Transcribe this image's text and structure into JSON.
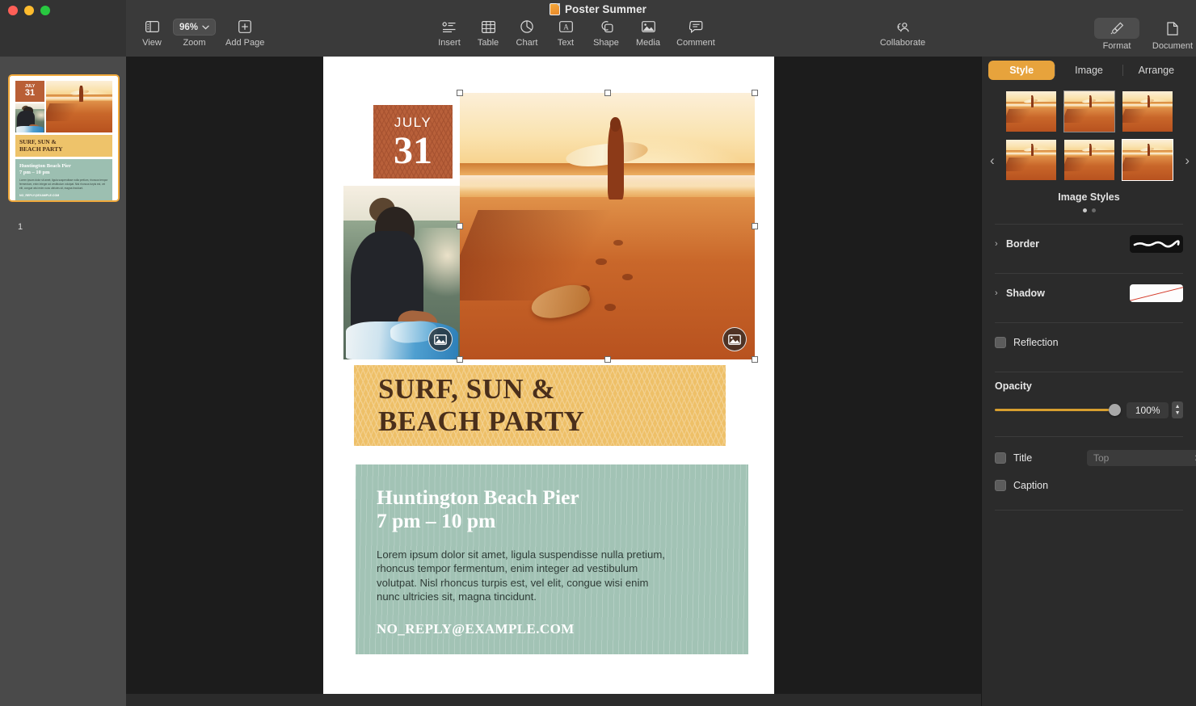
{
  "window": {
    "title": "Poster Summer",
    "traffic_lights": [
      "close",
      "minimize",
      "zoom"
    ]
  },
  "toolbar": {
    "left": [
      {
        "name": "view",
        "label": "View",
        "icon": "sidebar-icon"
      },
      {
        "name": "zoom",
        "label": "Zoom",
        "icon": "chevron-down-icon",
        "value": "96%"
      },
      {
        "name": "add-page",
        "label": "Add Page",
        "icon": "plus-box-icon"
      }
    ],
    "center": [
      {
        "name": "insert",
        "label": "Insert",
        "icon": "insert-icon"
      },
      {
        "name": "table",
        "label": "Table",
        "icon": "table-icon"
      },
      {
        "name": "chart",
        "label": "Chart",
        "icon": "chart-pie-icon"
      },
      {
        "name": "text",
        "label": "Text",
        "icon": "text-box-icon"
      },
      {
        "name": "shape",
        "label": "Shape",
        "icon": "shape-icon"
      },
      {
        "name": "media",
        "label": "Media",
        "icon": "media-image-icon"
      },
      {
        "name": "comment",
        "label": "Comment",
        "icon": "comment-icon"
      }
    ],
    "right": [
      {
        "name": "collaborate",
        "label": "Collaborate",
        "icon": "collaborate-icon"
      },
      {
        "name": "format",
        "label": "Format",
        "icon": "paintbrush-icon",
        "active": true
      },
      {
        "name": "document",
        "label": "Document",
        "icon": "document-icon"
      }
    ]
  },
  "navigator": {
    "page_number": "1",
    "thumbnail_selected": true
  },
  "poster": {
    "date": {
      "month": "JULY",
      "day": "31"
    },
    "headline_line1": "SURF, SUN &",
    "headline_line2": "BEACH PARTY",
    "venue_line1": "Huntington Beach Pier",
    "venue_line2": "7 pm – 10 pm",
    "body": "Lorem ipsum dolor sit amet, ligula suspendisse nulla pretium, rhoncus tempor fermentum, enim integer ad vestibulum volutpat. Nisl rhoncus turpis est, vel elit, congue wisi enim nunc ultricies sit, magna tincidunt.",
    "email": "NO_REPLY@EXAMPLE.COM",
    "images": [
      {
        "name": "surfer-on-wave-photo",
        "badge": "image-placeholder-icon"
      },
      {
        "name": "surfer-sunset-beach-photo",
        "badge": "image-placeholder-icon",
        "selected": true
      }
    ],
    "colors": {
      "date_badge": "#b8603a",
      "headline_band": "#eec068",
      "headline_text": "#4a2f1b",
      "info_panel": "#a2c3b5",
      "panel_heading": "#ffffff"
    }
  },
  "inspector": {
    "tabs": [
      {
        "name": "style",
        "label": "Style",
        "selected": true
      },
      {
        "name": "image",
        "label": "Image",
        "selected": false
      },
      {
        "name": "arrange",
        "label": "Arrange",
        "selected": false
      }
    ],
    "styles": {
      "label": "Image Styles",
      "prev_arrow": "‹",
      "next_arrow": "›",
      "page_dots": 2,
      "active_dot": 1,
      "cells": [
        {
          "name": "image-style-1",
          "selected": false
        },
        {
          "name": "image-style-2",
          "selected": "hover"
        },
        {
          "name": "image-style-3",
          "selected": false
        },
        {
          "name": "image-style-4",
          "selected": false
        },
        {
          "name": "image-style-5",
          "selected": false
        },
        {
          "name": "image-style-6",
          "selected": true
        }
      ]
    },
    "border": {
      "label": "Border",
      "disclosure": "›",
      "swatch": "none-line"
    },
    "shadow": {
      "label": "Shadow",
      "disclosure": "›",
      "swatch": "no-shadow-diagonal"
    },
    "reflection": {
      "label": "Reflection",
      "checked": false
    },
    "opacity": {
      "label": "Opacity",
      "value": "100%",
      "percent": 100,
      "accent": "#d79f2f"
    },
    "title": {
      "label": "Title",
      "checked": false,
      "position": "Top"
    },
    "caption": {
      "label": "Caption",
      "checked": false
    }
  }
}
